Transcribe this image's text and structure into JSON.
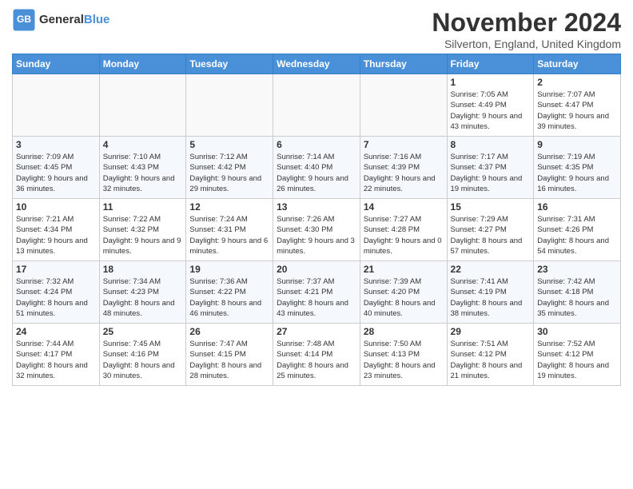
{
  "header": {
    "logo_line1": "General",
    "logo_line2": "Blue",
    "month_title": "November 2024",
    "subtitle": "Silverton, England, United Kingdom"
  },
  "days_of_week": [
    "Sunday",
    "Monday",
    "Tuesday",
    "Wednesday",
    "Thursday",
    "Friday",
    "Saturday"
  ],
  "weeks": [
    [
      {
        "day": "",
        "info": ""
      },
      {
        "day": "",
        "info": ""
      },
      {
        "day": "",
        "info": ""
      },
      {
        "day": "",
        "info": ""
      },
      {
        "day": "",
        "info": ""
      },
      {
        "day": "1",
        "info": "Sunrise: 7:05 AM\nSunset: 4:49 PM\nDaylight: 9 hours and 43 minutes."
      },
      {
        "day": "2",
        "info": "Sunrise: 7:07 AM\nSunset: 4:47 PM\nDaylight: 9 hours and 39 minutes."
      }
    ],
    [
      {
        "day": "3",
        "info": "Sunrise: 7:09 AM\nSunset: 4:45 PM\nDaylight: 9 hours and 36 minutes."
      },
      {
        "day": "4",
        "info": "Sunrise: 7:10 AM\nSunset: 4:43 PM\nDaylight: 9 hours and 32 minutes."
      },
      {
        "day": "5",
        "info": "Sunrise: 7:12 AM\nSunset: 4:42 PM\nDaylight: 9 hours and 29 minutes."
      },
      {
        "day": "6",
        "info": "Sunrise: 7:14 AM\nSunset: 4:40 PM\nDaylight: 9 hours and 26 minutes."
      },
      {
        "day": "7",
        "info": "Sunrise: 7:16 AM\nSunset: 4:39 PM\nDaylight: 9 hours and 22 minutes."
      },
      {
        "day": "8",
        "info": "Sunrise: 7:17 AM\nSunset: 4:37 PM\nDaylight: 9 hours and 19 minutes."
      },
      {
        "day": "9",
        "info": "Sunrise: 7:19 AM\nSunset: 4:35 PM\nDaylight: 9 hours and 16 minutes."
      }
    ],
    [
      {
        "day": "10",
        "info": "Sunrise: 7:21 AM\nSunset: 4:34 PM\nDaylight: 9 hours and 13 minutes."
      },
      {
        "day": "11",
        "info": "Sunrise: 7:22 AM\nSunset: 4:32 PM\nDaylight: 9 hours and 9 minutes."
      },
      {
        "day": "12",
        "info": "Sunrise: 7:24 AM\nSunset: 4:31 PM\nDaylight: 9 hours and 6 minutes."
      },
      {
        "day": "13",
        "info": "Sunrise: 7:26 AM\nSunset: 4:30 PM\nDaylight: 9 hours and 3 minutes."
      },
      {
        "day": "14",
        "info": "Sunrise: 7:27 AM\nSunset: 4:28 PM\nDaylight: 9 hours and 0 minutes."
      },
      {
        "day": "15",
        "info": "Sunrise: 7:29 AM\nSunset: 4:27 PM\nDaylight: 8 hours and 57 minutes."
      },
      {
        "day": "16",
        "info": "Sunrise: 7:31 AM\nSunset: 4:26 PM\nDaylight: 8 hours and 54 minutes."
      }
    ],
    [
      {
        "day": "17",
        "info": "Sunrise: 7:32 AM\nSunset: 4:24 PM\nDaylight: 8 hours and 51 minutes."
      },
      {
        "day": "18",
        "info": "Sunrise: 7:34 AM\nSunset: 4:23 PM\nDaylight: 8 hours and 48 minutes."
      },
      {
        "day": "19",
        "info": "Sunrise: 7:36 AM\nSunset: 4:22 PM\nDaylight: 8 hours and 46 minutes."
      },
      {
        "day": "20",
        "info": "Sunrise: 7:37 AM\nSunset: 4:21 PM\nDaylight: 8 hours and 43 minutes."
      },
      {
        "day": "21",
        "info": "Sunrise: 7:39 AM\nSunset: 4:20 PM\nDaylight: 8 hours and 40 minutes."
      },
      {
        "day": "22",
        "info": "Sunrise: 7:41 AM\nSunset: 4:19 PM\nDaylight: 8 hours and 38 minutes."
      },
      {
        "day": "23",
        "info": "Sunrise: 7:42 AM\nSunset: 4:18 PM\nDaylight: 8 hours and 35 minutes."
      }
    ],
    [
      {
        "day": "24",
        "info": "Sunrise: 7:44 AM\nSunset: 4:17 PM\nDaylight: 8 hours and 32 minutes."
      },
      {
        "day": "25",
        "info": "Sunrise: 7:45 AM\nSunset: 4:16 PM\nDaylight: 8 hours and 30 minutes."
      },
      {
        "day": "26",
        "info": "Sunrise: 7:47 AM\nSunset: 4:15 PM\nDaylight: 8 hours and 28 minutes."
      },
      {
        "day": "27",
        "info": "Sunrise: 7:48 AM\nSunset: 4:14 PM\nDaylight: 8 hours and 25 minutes."
      },
      {
        "day": "28",
        "info": "Sunrise: 7:50 AM\nSunset: 4:13 PM\nDaylight: 8 hours and 23 minutes."
      },
      {
        "day": "29",
        "info": "Sunrise: 7:51 AM\nSunset: 4:12 PM\nDaylight: 8 hours and 21 minutes."
      },
      {
        "day": "30",
        "info": "Sunrise: 7:52 AM\nSunset: 4:12 PM\nDaylight: 8 hours and 19 minutes."
      }
    ]
  ]
}
